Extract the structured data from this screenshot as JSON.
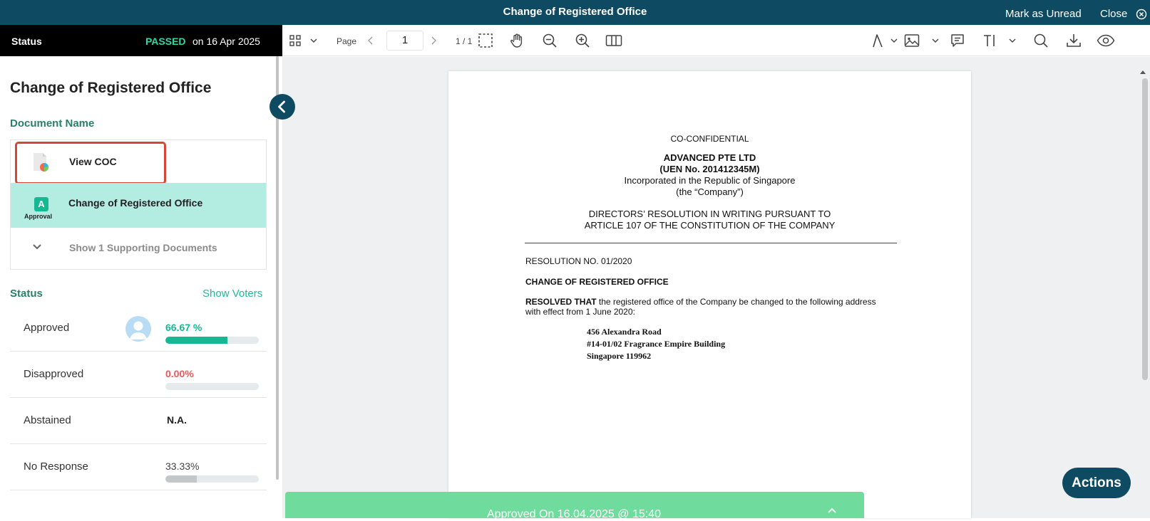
{
  "header": {
    "title": "Change of Registered Office",
    "mark_unread": "Mark as Unread",
    "close": "Close"
  },
  "status_bar": {
    "label": "Status",
    "result": "PASSED",
    "date": "on 16 Apr 2025"
  },
  "toolbar": {
    "page_label": "Page",
    "page_value": "1",
    "page_count": "1 / 1"
  },
  "sidebar": {
    "title": "Change of Registered Office",
    "document_name_label": "Document Name",
    "documents": [
      {
        "label": "View COC",
        "icon": "document-chart-icon"
      },
      {
        "label": "Change of Registered Office",
        "icon": "approval-icon",
        "sub": "Approval"
      },
      {
        "label": "Show 1 Supporting Documents",
        "icon": "chevron-down-icon"
      }
    ],
    "status_label": "Status",
    "show_voters": "Show Voters",
    "votes": [
      {
        "name": "Approved",
        "percent": "66.67 %",
        "fraction": 0.6667,
        "color": "#14b892"
      },
      {
        "name": "Disapproved",
        "percent": "0.00%",
        "fraction": 0,
        "color": "#f0555a"
      },
      {
        "name": "Abstained",
        "percent": "N.A."
      },
      {
        "name": "No Response",
        "percent": "33.33%",
        "fraction": 0.3333,
        "color": "#c4c7ca"
      }
    ]
  },
  "document": {
    "confidential": "CO-CONFIDENTIAL",
    "company": "ADVANCED PTE LTD",
    "uen": "(UEN No. 201412345M)",
    "incorporated": "Incorporated in the Republic of Singapore",
    "alias": "(the “Company”)",
    "heading1": "DIRECTORS’ RESOLUTION IN WRITING PURSUANT TO",
    "heading2": "ARTICLE 107 OF THE CONSTITUTION OF THE COMPANY",
    "resolution_no": "RESOLUTION NO. 01/2020",
    "resolution_title": "CHANGE OF REGISTERED OFFICE",
    "resolved_bold": "RESOLVED THAT",
    "resolved_text": " the registered office of the Company be changed to the following address",
    "resolved_text2": "with effect from 1 June 2020:",
    "address1": "456 Alexandra Road",
    "address2": "#14-01/02 Fragrance Empire Building",
    "address3": "Singapore 119962"
  },
  "footer": {
    "approved": "Approved On 16.04.2025 @ 15:40",
    "actions": "Actions"
  }
}
